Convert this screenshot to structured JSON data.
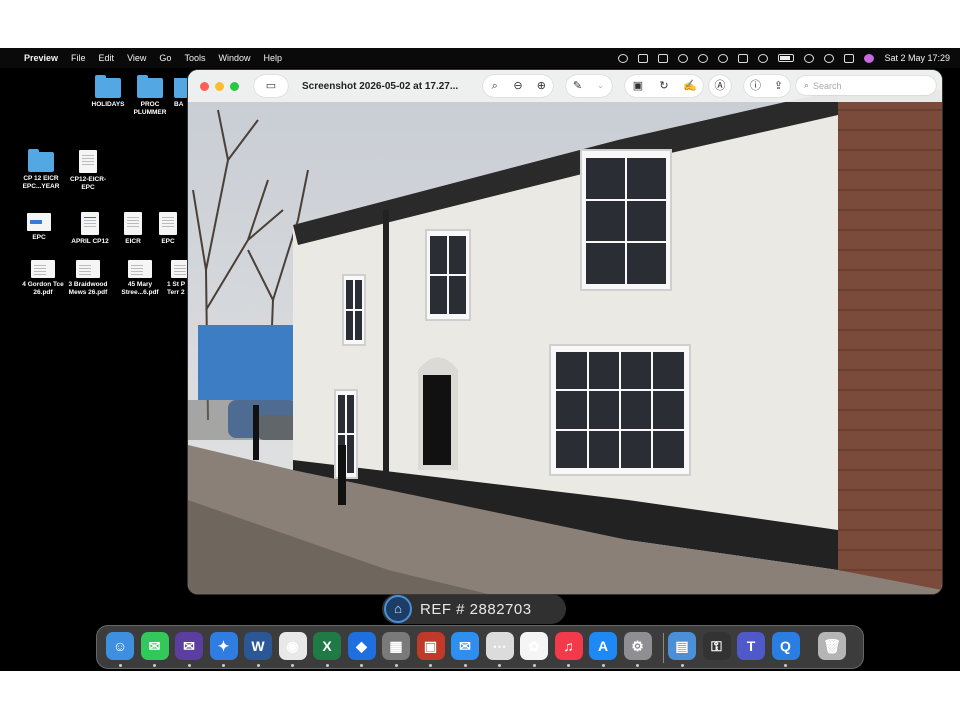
{
  "menubar": {
    "apple_glyph": "",
    "app_name": "Preview",
    "items": [
      "File",
      "Edit",
      "View",
      "Go",
      "Tools",
      "Window",
      "Help"
    ],
    "datetime": "Sat 2 May  17:29"
  },
  "desktop": {
    "items": [
      {
        "label": "HOLIDAYS",
        "kind": "folder"
      },
      {
        "label": "PROC PLUMMER",
        "kind": "folder"
      },
      {
        "label": "BA",
        "kind": "folder"
      },
      {
        "label": "CP 12 EICR EPC...YEAR",
        "kind": "folder"
      },
      {
        "label": "CP12-EICR-EPC",
        "kind": "doc"
      },
      {
        "label": "EPC",
        "kind": "doc-wide"
      },
      {
        "label": "APRIL CP12",
        "kind": "doc"
      },
      {
        "label": "EICR",
        "kind": "doc"
      },
      {
        "label": "EPC",
        "kind": "doc"
      },
      {
        "label": "4 Gordon Tce 26.pdf",
        "kind": "doc-wide"
      },
      {
        "label": "3 Braidwood Mews 26.pdf",
        "kind": "doc-wide"
      },
      {
        "label": "45 Mary Stree...6.pdf",
        "kind": "doc-wide"
      },
      {
        "label": "1 St P Terr 2",
        "kind": "doc-wide"
      }
    ]
  },
  "window": {
    "title": "Screenshot 2026-05-02 at 17.27...",
    "search_placeholder": "Search",
    "toolbar_icons": [
      "sidebar-toggle-icon",
      "zoom-out-icon",
      "zoom-in-icon",
      "zoom-fit-icon",
      "markup-pen-icon",
      "crop-icon",
      "rotate-icon",
      "sign-icon",
      "annotate-icon",
      "info-icon",
      "share-icon"
    ]
  },
  "reference": {
    "text": "REF # 2882703"
  },
  "dock": {
    "apps": [
      {
        "name": "finder-icon",
        "color": "#3f8fe0",
        "glyph": "☺"
      },
      {
        "name": "messages-icon",
        "color": "#34c759",
        "glyph": "✉"
      },
      {
        "name": "mail-icon",
        "color": "#5b3ea0",
        "glyph": "✉"
      },
      {
        "name": "safari-icon",
        "color": "#2f7de1",
        "glyph": "✦"
      },
      {
        "name": "word-icon",
        "color": "#2b5797",
        "glyph": "W"
      },
      {
        "name": "chrome-icon",
        "color": "#e8e8e8",
        "glyph": "◉"
      },
      {
        "name": "excel-icon",
        "color": "#1f7a45",
        "glyph": "X"
      },
      {
        "name": "dropbox-icon",
        "color": "#1f6fe0",
        "glyph": "◆"
      },
      {
        "name": "calculator-icon",
        "color": "#7a7a7a",
        "glyph": "▦"
      },
      {
        "name": "photo-booth-icon",
        "color": "#c0392b",
        "glyph": "▣"
      },
      {
        "name": "mail-blue-icon",
        "color": "#2e8ff0",
        "glyph": "✉"
      },
      {
        "name": "launchpad-icon",
        "color": "#dcdcdc",
        "glyph": "⋯"
      },
      {
        "name": "photos-icon",
        "color": "#f5f5f5",
        "glyph": "✿"
      },
      {
        "name": "music-icon",
        "color": "#f23a4b",
        "glyph": "♫"
      },
      {
        "name": "app-store-icon",
        "color": "#1e88f5",
        "glyph": "A"
      },
      {
        "name": "system-settings-icon",
        "color": "#8e8e93",
        "glyph": "⚙"
      },
      {
        "name": "preview-icon",
        "color": "#4a8fd8",
        "glyph": "▤"
      },
      {
        "name": "keychain-icon",
        "color": "#333333",
        "glyph": "⚿"
      },
      {
        "name": "teams-icon",
        "color": "#5059c9",
        "glyph": "T"
      },
      {
        "name": "quicktime-icon",
        "color": "#2a7de1",
        "glyph": "Q"
      },
      {
        "name": "trash-icon",
        "color": "#b5b5b5",
        "glyph": "🗑"
      }
    ]
  }
}
